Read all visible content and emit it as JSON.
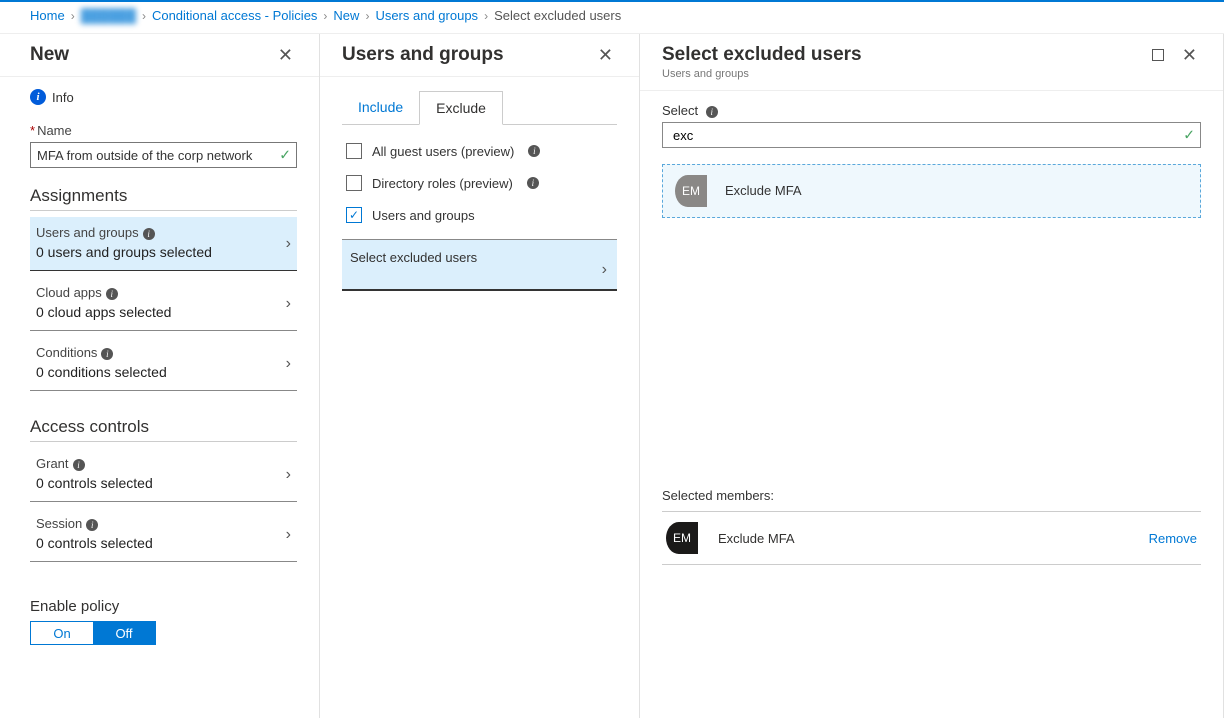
{
  "breadcrumb": {
    "home": "Home",
    "obscured": "██████",
    "policies": "Conditional access - Policies",
    "new": "New",
    "users_groups": "Users and groups",
    "current": "Select excluded users"
  },
  "new_blade": {
    "title": "New",
    "info_label": "Info",
    "name_label": "Name",
    "name_value": "MFA from outside of the corp network",
    "assignments_title": "Assignments",
    "users_groups_label": "Users and groups",
    "users_groups_value": "0 users and groups selected",
    "cloud_apps_label": "Cloud apps",
    "cloud_apps_value": "0 cloud apps selected",
    "conditions_label": "Conditions",
    "conditions_value": "0 conditions selected",
    "access_controls_title": "Access controls",
    "grant_label": "Grant",
    "grant_value": "0 controls selected",
    "session_label": "Session",
    "session_value": "0 controls selected",
    "enable_policy_label": "Enable policy",
    "toggle_on": "On",
    "toggle_off": "Off"
  },
  "ug_blade": {
    "title": "Users and groups",
    "tab_include": "Include",
    "tab_exclude": "Exclude",
    "opt_guest": "All guest users (preview)",
    "opt_roles": "Directory roles (preview)",
    "opt_users_groups": "Users and groups",
    "select_excluded": "Select excluded users"
  },
  "select_blade": {
    "title": "Select excluded users",
    "subtitle": "Users and groups",
    "select_label": "Select",
    "search_value": "exc",
    "result_avatar": "EM",
    "result_name": "Exclude MFA",
    "selected_members_label": "Selected members:",
    "selected_avatar": "EM",
    "selected_name": "Exclude MFA",
    "remove_label": "Remove"
  }
}
